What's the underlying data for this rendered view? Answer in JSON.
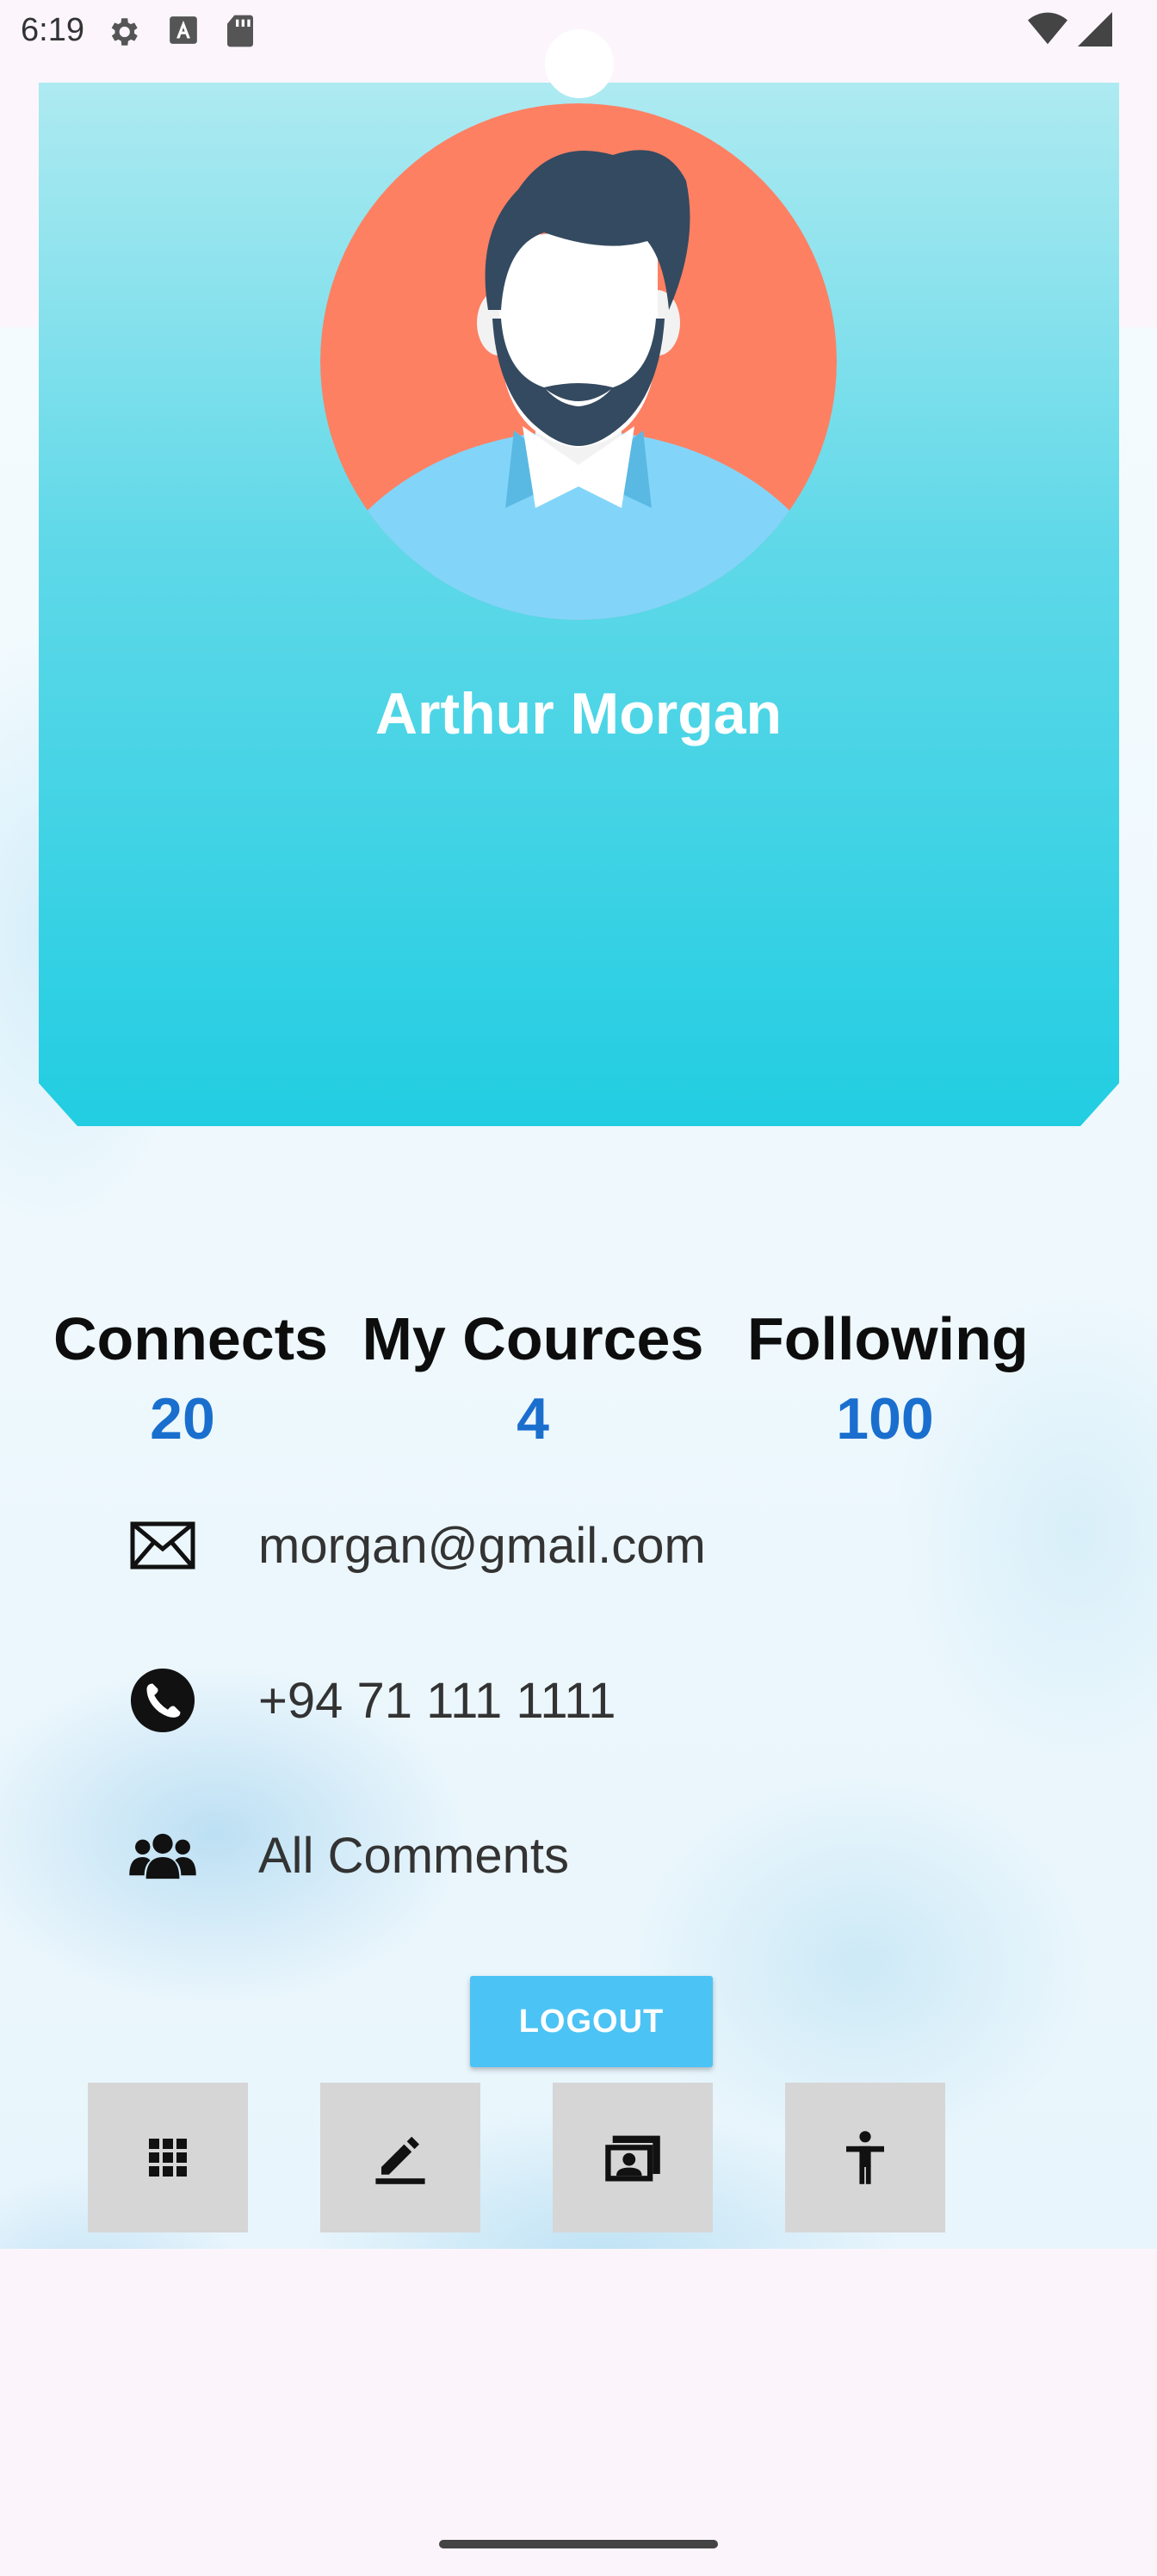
{
  "status_bar": {
    "time": "6:19",
    "icons_left": [
      "settings-icon",
      "font-a-icon",
      "sd-card-icon"
    ],
    "icons_right": [
      "wifi-icon",
      "cellular-signal-icon"
    ]
  },
  "profile": {
    "name": "Arthur Morgan",
    "avatar": "male-avatar-with-beard"
  },
  "stats": [
    {
      "label": "Connects",
      "value": "20"
    },
    {
      "label": "My Cources",
      "value": "4"
    },
    {
      "label": "Following",
      "value": "100"
    }
  ],
  "info": {
    "email": "morgan@gmail.com",
    "phone": "+94 71 111 1111",
    "comments": "All Comments"
  },
  "actions": {
    "logout_label": "LOGOUT"
  },
  "bottom_nav": [
    "grid-icon",
    "edit-icon",
    "contact-card-icon",
    "accessibility-icon"
  ],
  "colors": {
    "header_top": "#aeeaf1",
    "header_bottom": "#22cde2",
    "stat_value": "#1a6fce",
    "logout": "#4cc3f5",
    "avatar_bg": "#fd8063"
  }
}
